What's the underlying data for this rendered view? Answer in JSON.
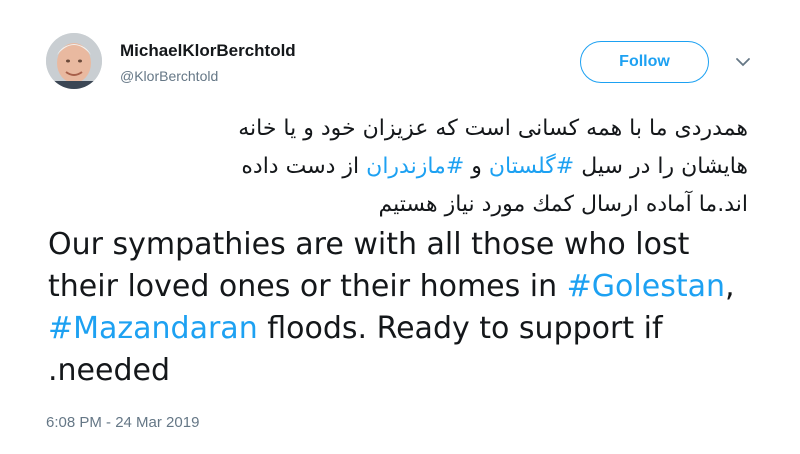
{
  "user": {
    "display_name": "MichaelKlorBerchtold",
    "handle": "@KlorBerchtold"
  },
  "follow_button": {
    "label": "Follow"
  },
  "icons": {
    "avatar": "avatar-photo",
    "menu": "chevron-down-icon"
  },
  "colors": {
    "accent": "#1da1f2",
    "secondary_text": "#657786",
    "text": "#14171a"
  },
  "tweet": {
    "fa_line1": "همدردی ما با همه کسانی است که عزیزان خود و یا خانه",
    "fa_line2_pre": "هایشان را در سیل ",
    "fa_tag1": "#گلستان",
    "fa_line2_mid": " و ",
    "fa_tag2": "#مازندران",
    "fa_line2_post": " از دست داده",
    "fa_line3": "اند.ما آماده ارسال کمك مورد نیاز هستیم",
    "en_line1": "Our sympathies are with all those who lost",
    "en_line2_pre": "their loved ones or their homes in ",
    "en_tag1": "#Golestan",
    "en_line2_post": ",",
    "en_tag2": "#Mazandaran",
    "en_line3_post": " floods. Ready to support if",
    "en_line4": ".needed"
  },
  "timestamp": "6:08 PM - 24 Mar 2019"
}
